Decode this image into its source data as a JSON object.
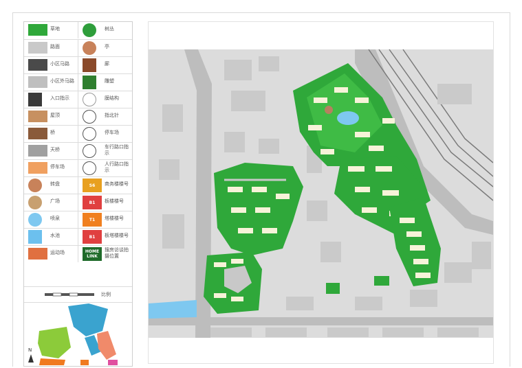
{
  "legend": {
    "rows": [
      {
        "left": {
          "label": "草地",
          "icon": "grass-swatch",
          "color": "#2fa83a"
        },
        "right": {
          "label": "树丛",
          "icon": "tree-cluster-icon",
          "color": "#2e9e3b"
        }
      },
      {
        "left": {
          "label": "路面",
          "icon": "pavement-swatch",
          "color": "#c9c9c9"
        },
        "right": {
          "label": "亭",
          "icon": "pavilion-icon",
          "color": "#c8825a"
        }
      },
      {
        "left": {
          "label": "小区马路",
          "icon": "estate-road-swatch",
          "color": "#4a4a4a"
        },
        "right": {
          "label": "廊",
          "icon": "corridor-icon",
          "color": "#8a4a2a"
        }
      },
      {
        "left": {
          "label": "小区外马路",
          "icon": "outer-road-swatch",
          "color": "#bfbfbf"
        },
        "right": {
          "label": "雕塑",
          "icon": "sculpture-icon",
          "color": "#2f7f2f"
        }
      },
      {
        "left": {
          "label": "入口指示",
          "icon": "entrance-arrow-icon",
          "color": "#3a3a3a"
        },
        "right": {
          "label": "膜结构",
          "icon": "membrane-structure-icon",
          "color": "#9a9a9a"
        }
      },
      {
        "left": {
          "label": "屋顶",
          "icon": "roof-icon",
          "color": "#c79060"
        },
        "right": {
          "label": "指北针",
          "icon": "north-arrow-icon",
          "color": "#555555"
        }
      },
      {
        "left": {
          "label": "桥",
          "icon": "bridge-icon",
          "color": "#8a5a3a"
        },
        "right": {
          "label": "停车场",
          "icon": "parking-icon",
          "color": "#555555"
        }
      },
      {
        "left": {
          "label": "天桥",
          "icon": "overpass-icon",
          "color": "#a0a0a0"
        },
        "right": {
          "label": "车行路口指示",
          "icon": "vehicle-entrance-icon",
          "color": "#555555"
        }
      },
      {
        "left": {
          "label": "停车场",
          "icon": "parking-lot-swatch",
          "color": "#f0a060"
        },
        "right": {
          "label": "人行路口指示",
          "icon": "pedestrian-entrance-icon",
          "color": "#555555"
        }
      },
      {
        "left": {
          "label": "转盘",
          "icon": "roundabout-icon",
          "color": "#c8825a"
        },
        "right": {
          "label": "商务楼楼号",
          "icon": "commercial-building-number-icon",
          "color": "#e8a020",
          "code": "S6"
        }
      },
      {
        "left": {
          "label": "广场",
          "icon": "plaza-icon",
          "color": "#c8a070"
        },
        "right": {
          "label": "板楼楼号",
          "icon": "slab-building-number-icon",
          "color": "#e04040",
          "code": "B1"
        }
      },
      {
        "left": {
          "label": "喷泉",
          "icon": "fountain-icon",
          "color": "#7ec8f0"
        },
        "right": {
          "label": "塔楼楼号",
          "icon": "tower-building-number-icon",
          "color": "#f08020",
          "code": "T1"
        }
      },
      {
        "left": {
          "label": "水池",
          "icon": "pool-icon",
          "color": "#6cc0ee"
        },
        "right": {
          "label": "板塔楼楼号",
          "icon": "slab-tower-building-number-icon",
          "color": "#e04040",
          "code": "B1"
        }
      },
      {
        "left": {
          "label": "运动场",
          "icon": "sports-field-icon",
          "color": "#e07040"
        },
        "right": {
          "label": "搜房访谈拍摄位置",
          "icon": "homelink-photo-spot-icon",
          "color": "#1f6b2a",
          "code": "HOME LINK"
        }
      }
    ],
    "scale_label": "比例",
    "north_label": "N"
  },
  "colors": {
    "grass": "#2fa83a",
    "dark_green": "#1f7f2a",
    "road": "#a9a9a9",
    "block": "#d6d6d6",
    "building": "#f7f3d9",
    "water": "#7ec8f0",
    "rail": "#777777"
  }
}
